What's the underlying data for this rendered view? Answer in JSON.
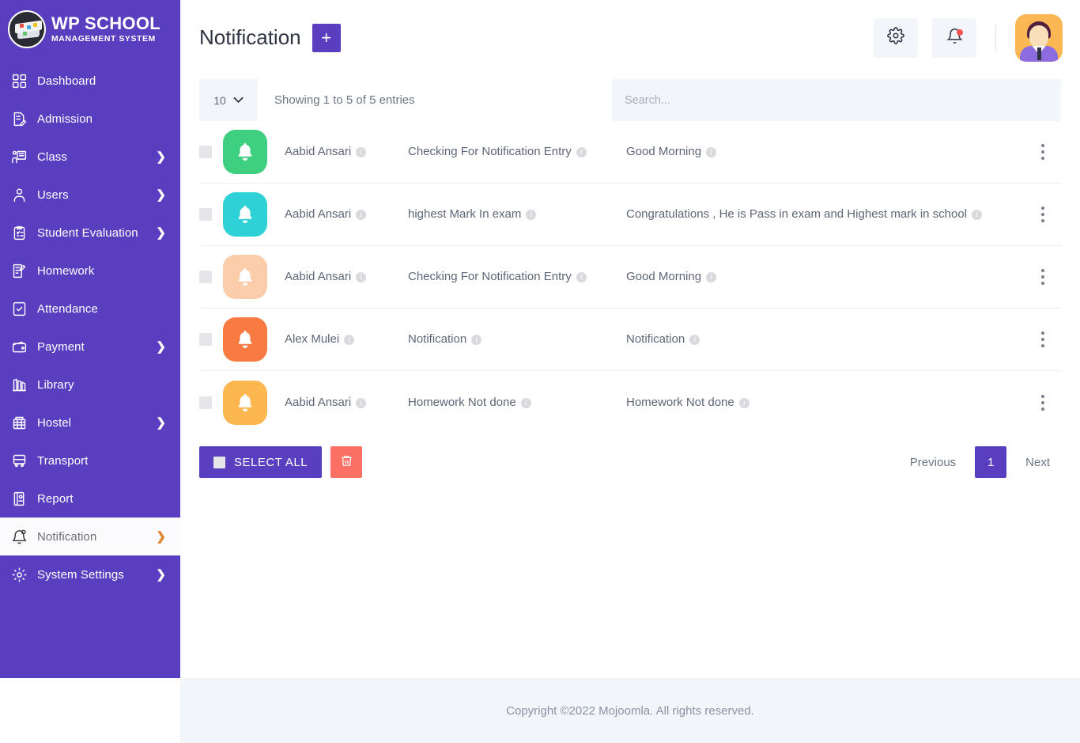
{
  "brand": {
    "title": "WP SCHOOL",
    "subtitle": "MANAGEMENT SYSTEM",
    "logo_icon": "graduation-cap-logo"
  },
  "colors": {
    "sidebar_bg": "#5a3ec0",
    "primary": "#5a3ec0",
    "danger": "#fb7064",
    "badge_dot": "#fb5252",
    "toolbar_field": "#f2f5f9",
    "footer_bg": "#f2f5fa"
  },
  "sidebar": {
    "items": [
      {
        "label": "Dashboard",
        "icon": "grid-icon",
        "chevron": false,
        "active": false
      },
      {
        "label": "Admission",
        "icon": "document-edit-icon",
        "chevron": false,
        "active": false
      },
      {
        "label": "Class",
        "icon": "class-board-icon",
        "chevron": true,
        "active": false
      },
      {
        "label": "Users",
        "icon": "user-icon",
        "chevron": true,
        "active": false
      },
      {
        "label": "Student Evaluation",
        "icon": "clipboard-check-icon",
        "chevron": true,
        "active": false
      },
      {
        "label": "Homework",
        "icon": "book-pencil-icon",
        "chevron": false,
        "active": false
      },
      {
        "label": "Attendance",
        "icon": "checkbox-icon",
        "chevron": false,
        "active": false
      },
      {
        "label": "Payment",
        "icon": "wallet-icon",
        "chevron": true,
        "active": false
      },
      {
        "label": "Library",
        "icon": "books-icon",
        "chevron": false,
        "active": false
      },
      {
        "label": "Hostel",
        "icon": "hostel-icon",
        "chevron": true,
        "active": false
      },
      {
        "label": "Transport",
        "icon": "bus-icon",
        "chevron": false,
        "active": false
      },
      {
        "label": "Report",
        "icon": "report-icon",
        "chevron": false,
        "active": false
      },
      {
        "label": "Notification",
        "icon": "bell-icon",
        "chevron": true,
        "active": true
      },
      {
        "label": "System Settings",
        "icon": "gear-icon",
        "chevron": true,
        "active": false
      }
    ]
  },
  "header": {
    "title": "Notification",
    "add_label": "+",
    "settings_icon": "gear-icon",
    "notification_icon": "bell-icon",
    "avatar_icon": "user-avatar"
  },
  "toolbar": {
    "page_length": "10",
    "chevron_icon": "chevron-down-icon",
    "showing_text": "Showing 1 to 5 of 5 entries",
    "search_placeholder": "Search...",
    "search_value": ""
  },
  "table": {
    "rows": [
      {
        "avatar_color": "#3ecf81",
        "avatar_icon": "bell-icon",
        "name": "Aabid Ansari",
        "title": "Checking For Notification Entry",
        "message": "Good Morning"
      },
      {
        "avatar_color": "#2ed1d6",
        "avatar_icon": "bell-icon",
        "name": "Aabid Ansari",
        "title": "highest Mark In exam",
        "message": "Congratulations , He is Pass in exam and Highest mark in school"
      },
      {
        "avatar_color": "#fbcdab",
        "avatar_icon": "bell-icon",
        "name": "Aabid Ansari",
        "title": "Checking For Notification Entry",
        "message": "Good Morning"
      },
      {
        "avatar_color": "#f97b42",
        "avatar_icon": "bell-icon",
        "name": "Alex Mulei",
        "title": "Notification",
        "message": "Notification"
      },
      {
        "avatar_color": "#fcb750",
        "avatar_icon": "bell-icon",
        "name": "Aabid Ansari",
        "title": "Homework Not done",
        "message": "Homework Not done"
      }
    ]
  },
  "actions": {
    "select_all_label": "SELECT ALL",
    "delete_icon": "trash-icon"
  },
  "pagination": {
    "previous_label": "Previous",
    "current_page": "1",
    "next_label": "Next"
  },
  "footer": {
    "text": "Copyright ©2022 Mojoomla. All rights reserved."
  }
}
